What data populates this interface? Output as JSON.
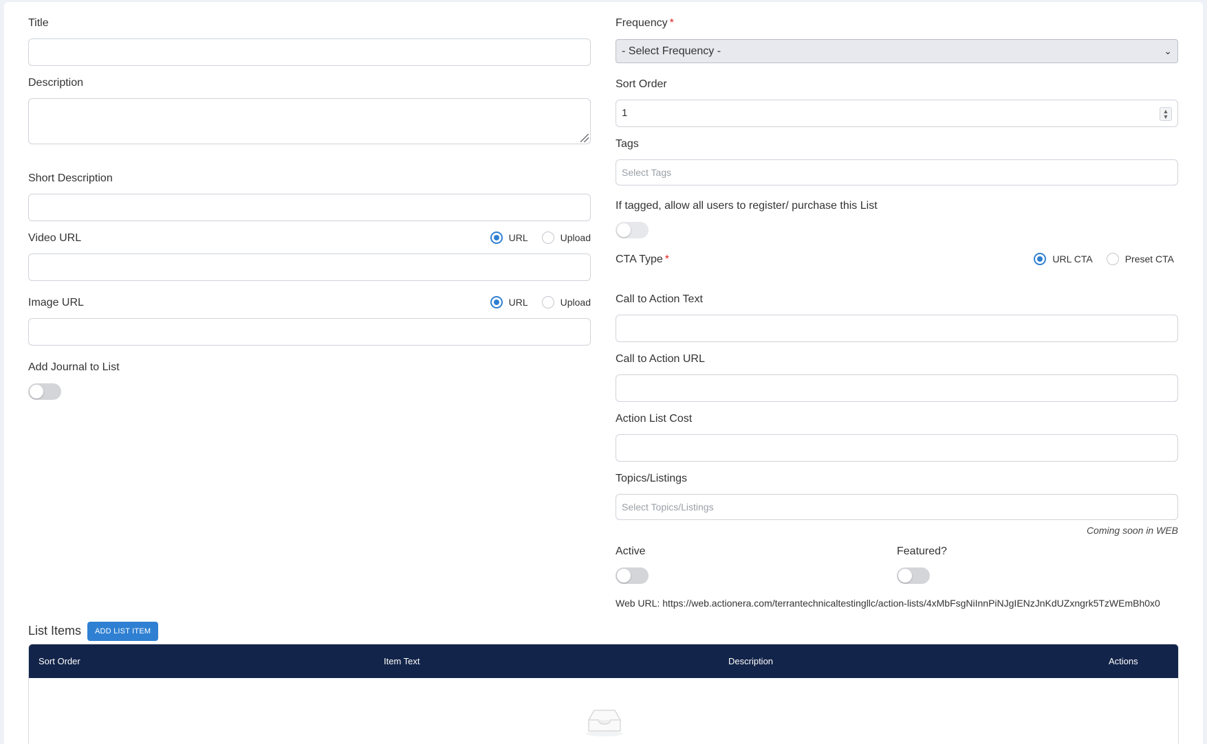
{
  "left": {
    "title_label": "Title",
    "description_label": "Description",
    "short_description_label": "Short Description",
    "video_url_label": "Video URL",
    "image_url_label": "Image URL",
    "radio_url": "URL",
    "radio_upload": "Upload",
    "add_journal_label": "Add Journal to List"
  },
  "right": {
    "frequency_label": "Frequency",
    "frequency_value": "- Select Frequency -",
    "sort_order_label": "Sort Order",
    "sort_order_value": "1",
    "tags_label": "Tags",
    "tags_placeholder": "Select Tags",
    "tagged_label": "If tagged, allow all users to register/ purchase this List",
    "cta_type_label": "CTA Type",
    "cta_url": "URL CTA",
    "cta_preset": "Preset CTA",
    "cta_text_label": "Call to Action Text",
    "cta_url_label": "Call to Action URL",
    "cost_label": "Action List Cost",
    "topics_label": "Topics/Listings",
    "topics_placeholder": "Select Topics/Listings",
    "coming_soon": "Coming soon in WEB",
    "active_label": "Active",
    "featured_label": "Featured?",
    "web_url": "Web URL: https://web.actionera.com/terrantechnicaltestingllc/action-lists/4xMbFsgNiInnPiNJgIENzJnKdUZxngrk5TzWEmBh0x0"
  },
  "list": {
    "title": "List Items",
    "add_button": "ADD LIST ITEM",
    "columns": [
      "Sort Order",
      "Item Text",
      "Description",
      "Actions"
    ]
  },
  "icons": {
    "empty": "inbox-icon",
    "select_chevron": "chevron-down-icon",
    "spinner": "spinner-arrows-icon"
  },
  "colors": {
    "accent": "#2f80d2",
    "table_header": "#13244a",
    "required": "#e02424"
  }
}
